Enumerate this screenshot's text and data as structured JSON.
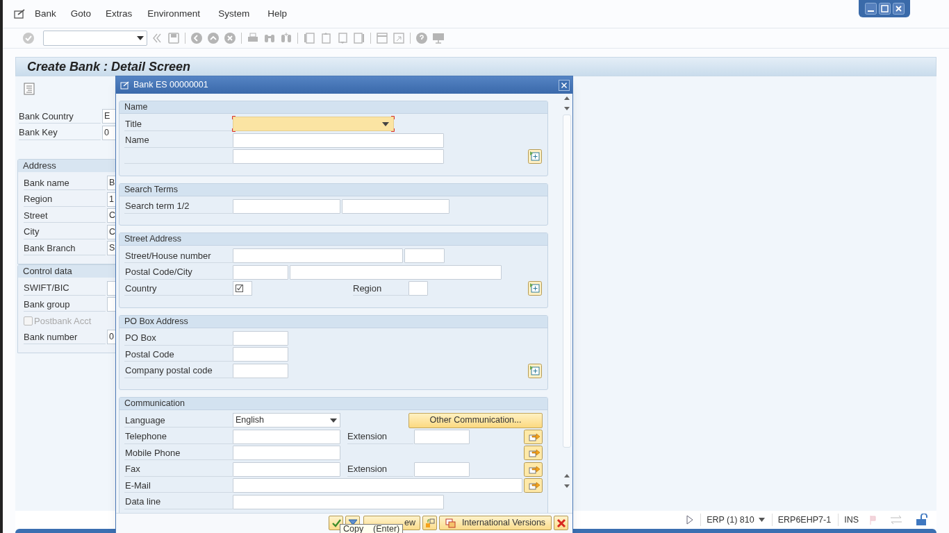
{
  "menu": [
    {
      "label": "Bank"
    },
    {
      "label": "Goto"
    },
    {
      "label": "Extras"
    },
    {
      "label": "Environment"
    },
    {
      "label": "System"
    },
    {
      "label": "Help"
    }
  ],
  "title": "Create Bank : Detail Screen",
  "header_fields": [
    {
      "label": "Bank Country",
      "value": "E"
    },
    {
      "label": "Bank Key",
      "value": "0"
    }
  ],
  "groups": [
    {
      "title": "Address",
      "fields": [
        {
          "kind": "field",
          "label": "Bank name",
          "value": "B"
        },
        {
          "kind": "field",
          "label": "Region",
          "value": "1"
        },
        {
          "kind": "field",
          "label": "Street",
          "value": "C"
        },
        {
          "kind": "field",
          "label": "City",
          "value": "C"
        },
        {
          "kind": "field",
          "label": "Bank Branch",
          "value": "S"
        }
      ]
    },
    {
      "title": "Control data",
      "fields": [
        {
          "kind": "field",
          "label": "SWIFT/BIC"
        },
        {
          "kind": "field",
          "label": "Bank group"
        },
        {
          "kind": "checkbox",
          "label": "Postbank Acct",
          "checked": false,
          "disabled": true
        },
        {
          "kind": "field",
          "label": "Bank number",
          "value": "0"
        }
      ]
    }
  ],
  "dialog": {
    "title": "Bank ES 00000001",
    "sections": [
      {
        "title": "Name",
        "rows": [
          {
            "kind": "title",
            "label": "Title"
          },
          {
            "kind": "text",
            "label": "Name"
          },
          {
            "kind": "text-more"
          }
        ]
      },
      {
        "title": "Search Terms",
        "rows": [
          {
            "kind": "pair",
            "label": "Search term 1/2"
          }
        ]
      },
      {
        "title": "Street Address",
        "rows": [
          {
            "kind": "street",
            "label": "Street/House number"
          },
          {
            "kind": "postal",
            "label": "Postal Code/City"
          },
          {
            "kind": "country",
            "label": "Country",
            "second_label": "Region"
          }
        ]
      },
      {
        "title": "PO Box Address",
        "rows": [
          {
            "kind": "short",
            "label": "PO Box"
          },
          {
            "kind": "short",
            "label": "Postal Code"
          },
          {
            "kind": "short-more",
            "label": "Company postal code"
          }
        ]
      },
      {
        "title": "Communication",
        "rows": [
          {
            "kind": "language",
            "label": "Language",
            "value": "English",
            "button": "Other Communication..."
          },
          {
            "kind": "phone",
            "label": "Telephone",
            "second_label": "Extension"
          },
          {
            "kind": "mobile",
            "label": "Mobile Phone"
          },
          {
            "kind": "phone",
            "label": "Fax",
            "second_label": "Extension"
          },
          {
            "kind": "email",
            "label": "E-Mail"
          },
          {
            "kind": "dataline",
            "label": "Data line"
          }
        ]
      }
    ],
    "footer_buttons": [
      {
        "kind": "check"
      },
      {
        "kind": "filter"
      },
      {
        "kind": "doc",
        "label": "ew"
      },
      {
        "kind": "swap"
      },
      {
        "kind": "versions",
        "label": "International Versions"
      },
      {
        "kind": "cancel"
      }
    ],
    "tooltip": "Copy    (Enter)"
  },
  "status": {
    "system": "ERP (1) 810",
    "server": "ERP6EHP7-1",
    "mode": "INS"
  }
}
